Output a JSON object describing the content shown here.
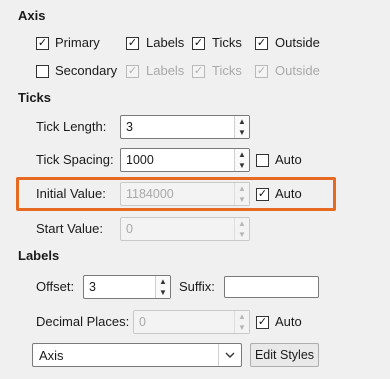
{
  "axis": {
    "title": "Axis",
    "primary_label": "Primary",
    "labels_label": "Labels",
    "ticks_label": "Ticks",
    "outside_label": "Outside",
    "secondary_label": "Secondary",
    "secondary_labels_label": "Labels",
    "secondary_ticks_label": "Ticks",
    "secondary_outside_label": "Outside",
    "primary_checked": true,
    "labels_checked": true,
    "ticks_checked": true,
    "outside_checked": true,
    "secondary_checked": false
  },
  "ticks": {
    "title": "Ticks",
    "tick_length_label": "Tick Length:",
    "tick_length_value": "3",
    "tick_spacing_label": "Tick Spacing:",
    "tick_spacing_value": "1000",
    "tick_spacing_auto_label": "Auto",
    "tick_spacing_auto_checked": false,
    "initial_value_label": "Initial Value:",
    "initial_value_value": "1184000",
    "initial_value_auto_label": "Auto",
    "initial_value_auto_checked": true,
    "start_value_label": "Start Value:",
    "start_value_value": "0"
  },
  "labels": {
    "title": "Labels",
    "offset_label": "Offset:",
    "offset_value": "3",
    "suffix_label": "Suffix:",
    "suffix_value": "",
    "decimal_places_label": "Decimal Places:",
    "decimal_places_value": "0",
    "decimal_auto_label": "Auto",
    "decimal_auto_checked": true,
    "style_select_value": "Axis",
    "edit_styles_label": "Edit Styles"
  },
  "colors": {
    "highlight": "#e66a22"
  }
}
